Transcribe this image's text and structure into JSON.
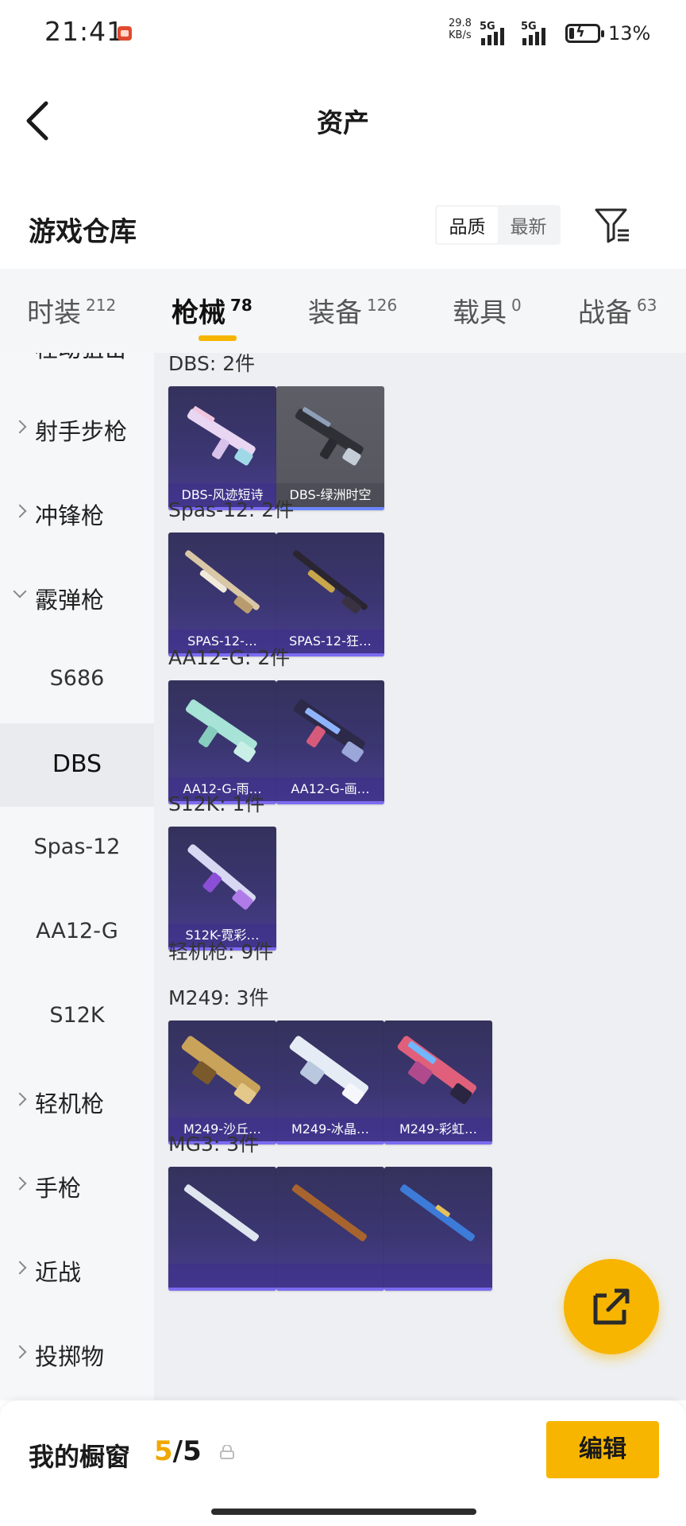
{
  "status_bar": {
    "time": "21:41",
    "net_speed_value": "29.8",
    "net_speed_unit": "KB/s",
    "signal1_label": "5G",
    "signal2_label": "5G",
    "battery_percent": "13%",
    "battery_level": 0.13
  },
  "header": {
    "title": "资产",
    "back_icon": "chevron-left-icon"
  },
  "section": {
    "title": "游戏仓库",
    "sort_options": [
      "品质",
      "最新"
    ],
    "sort_selected": "品质",
    "filter_icon": "filter-icon"
  },
  "tabs": [
    {
      "label": "时装",
      "count": "212"
    },
    {
      "label": "枪械",
      "count": "78",
      "active": true
    },
    {
      "label": "装备",
      "count": "126"
    },
    {
      "label": "载具",
      "count": "0"
    },
    {
      "label": "战备",
      "count": "63"
    }
  ],
  "sidebar": {
    "items": [
      {
        "label": "栓动狙击",
        "expanded": false
      },
      {
        "label": "射手步枪",
        "expanded": false
      },
      {
        "label": "冲锋枪",
        "expanded": false
      },
      {
        "label": "霰弹枪",
        "expanded": true
      },
      {
        "label": "S686",
        "sub": true
      },
      {
        "label": "DBS",
        "sub": true,
        "active": true
      },
      {
        "label": "Spas-12",
        "sub": true
      },
      {
        "label": "AA12-G",
        "sub": true
      },
      {
        "label": "S12K",
        "sub": true
      },
      {
        "label": "轻机枪",
        "expanded": false
      },
      {
        "label": "手枪",
        "expanded": false
      },
      {
        "label": "近战",
        "expanded": false
      },
      {
        "label": "投掷物",
        "expanded": false
      }
    ]
  },
  "content": {
    "groups": [
      {
        "title": "DBS: 2件",
        "items": [
          {
            "name": "DBS-风迹短诗",
            "rarity": "purple"
          },
          {
            "name": "DBS-绿洲时空",
            "rarity": "gray"
          }
        ]
      },
      {
        "title": "Spas-12: 2件",
        "items": [
          {
            "name": "SPAS-12-…",
            "rarity": "purple"
          },
          {
            "name": "SPAS-12-狂…",
            "rarity": "purple"
          }
        ]
      },
      {
        "title": "AA12-G: 2件",
        "items": [
          {
            "name": "AA12-G-雨…",
            "rarity": "purple"
          },
          {
            "name": "AA12-G-画…",
            "rarity": "purple"
          }
        ]
      },
      {
        "title": "S12K: 1件",
        "items": [
          {
            "name": "S12K-霓彩…",
            "rarity": "purple"
          }
        ]
      },
      {
        "title": "轻机枪: 9件",
        "items": []
      },
      {
        "title": "M249: 3件",
        "items": [
          {
            "name": "M249-沙丘…",
            "rarity": "purple"
          },
          {
            "name": "M249-冰晶…",
            "rarity": "purple"
          },
          {
            "name": "M249-彩虹…",
            "rarity": "purple"
          }
        ]
      },
      {
        "title": "MG3: 3件",
        "items": [
          {
            "name": "",
            "rarity": "purple"
          },
          {
            "name": "",
            "rarity": "purple"
          },
          {
            "name": "",
            "rarity": "purple"
          }
        ]
      }
    ]
  },
  "fab": {
    "icon": "share-icon"
  },
  "bottom_bar": {
    "title": "我的橱窗",
    "count_current": "5",
    "count_sep": "/",
    "count_total": "5",
    "lock_icon": "lock-icon",
    "edit_label": "编辑"
  },
  "colors": {
    "accent": "#f7b500",
    "card_purple": "#3b3672",
    "card_gray": "#55565e",
    "content_bg": "#edeff2",
    "sidebar_bg": "#f6f7f9"
  }
}
